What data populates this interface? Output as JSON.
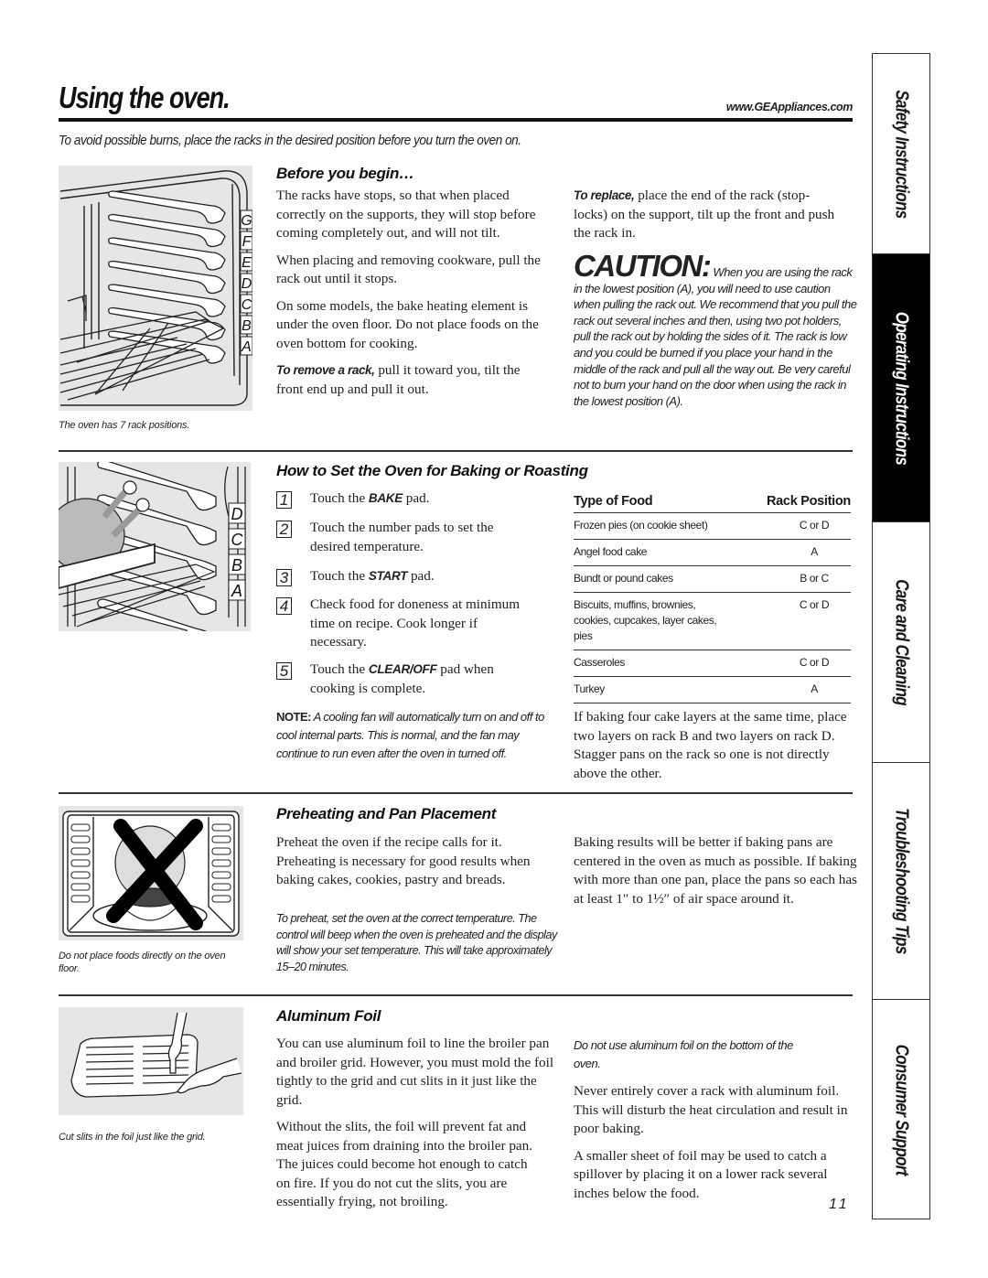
{
  "header": {
    "title": "Using the oven.",
    "url": "www.GEAppliances.com",
    "intro": "To avoid possible burns, place the racks in the desired position before you turn the oven on."
  },
  "side_tabs": [
    {
      "label": "Safety Instructions",
      "active": false
    },
    {
      "label": "Operating Instructions",
      "active": true
    },
    {
      "label": "Care and Cleaning",
      "active": false
    },
    {
      "label": "Troubleshooting Tips",
      "active": false
    },
    {
      "label": "Consumer Support",
      "active": false
    }
  ],
  "before_you_begin": {
    "heading": "Before you begin…",
    "illustration_labels": [
      "G",
      "F",
      "E",
      "D",
      "C",
      "B",
      "A"
    ],
    "caption": "The oven has 7 rack positions.",
    "paragraphs": [
      "The racks have stops, so that when placed correctly on the supports, they will stop before coming completely out, and will not tilt.",
      "When placing and removing cookware, pull the rack out until it stops.",
      "On some models, the bake heating element is under the oven floor. Do not place foods on the oven bottom for cooking."
    ],
    "remove": {
      "lead": "To remove a rack,",
      "text": " pull it toward you, tilt the front end up and pull it out."
    },
    "replace": {
      "lead": "To replace,",
      "text": " place the end of the rack (stop-locks) on the support, tilt up the front and push the rack in."
    },
    "caution": {
      "word": "CAUTION:",
      "text": " When you are using the rack in the lowest position (A), you will need to use caution when pulling the rack out. We recommend that you pull the rack out several inches and then, using two pot holders, pull the rack out by holding the sides of it. The rack is low and you could be burned if you place your hand in the middle of the rack and pull all the way out. Be very careful not to burn your hand on the door when using the rack in the lowest position (A)."
    }
  },
  "baking": {
    "heading": "How to Set the Oven for Baking or Roasting",
    "illustration_labels": [
      "D",
      "C",
      "B",
      "A"
    ],
    "steps": [
      {
        "num": "1",
        "pre": "Touch the ",
        "key": "BAKE",
        "post": " pad."
      },
      {
        "num": "2",
        "pre": "Touch the number pads to set the desired temperature.",
        "key": "",
        "post": ""
      },
      {
        "num": "3",
        "pre": "Touch the ",
        "key": "START",
        "post": " pad."
      },
      {
        "num": "4",
        "pre": "Check food for doneness at minimum time on recipe. Cook longer if necessary.",
        "key": "",
        "post": ""
      },
      {
        "num": "5",
        "pre": "Touch the ",
        "key": "CLEAR/OFF",
        "post": " pad when cooking is complete."
      }
    ],
    "note_label": "NOTE:",
    "note_text": " A cooling fan will automatically turn on and off to cool internal parts. This is normal, and the fan may continue to run even after the oven in turned off.",
    "table": {
      "headers": [
        "Type of Food",
        "Rack Position"
      ],
      "rows": [
        {
          "food": "Frozen pies (on cookie sheet)",
          "position": "C or D"
        },
        {
          "food": "Angel food cake",
          "position": "A"
        },
        {
          "food": "Bundt or pound cakes",
          "position": "B or C"
        },
        {
          "food": "Biscuits, muffins, brownies, cookies, cupcakes, layer cakes, pies",
          "position": "C or D"
        },
        {
          "food": "Casseroles",
          "position": "C or D"
        },
        {
          "food": "Turkey",
          "position": "A"
        }
      ]
    },
    "cake_layers": "If baking four cake layers at the same time, place two layers on rack B and two layers on rack D. Stagger pans on the rack so one is not directly above the other."
  },
  "preheating": {
    "heading": "Preheating and Pan Placement",
    "caption": "Do not place foods directly on the oven floor.",
    "paragraph": "Preheat the oven if the recipe calls for it. Preheating is necessary for good results when baking cakes, cookies, pastry and breads.",
    "italic_note": "To preheat, set the oven at the correct temperature. The control will beep when the oven is preheated and the display will show your set temperature. This will take approximately 15–20 minutes.",
    "pan_placement": "Baking results will be better if baking pans are centered in the oven as much as possible. If baking with more than one pan, place the pans so each has at least 1″ to 1½″ of air space around it."
  },
  "aluminum_foil": {
    "heading": "Aluminum Foil",
    "caption": "Cut slits in the foil just like the grid.",
    "paragraphs": [
      "You can use aluminum foil to line the broiler pan and broiler grid. However, you must mold the foil tightly to the grid and cut slits in it just like the grid.",
      "Without the slits, the foil will prevent fat and meat juices from draining into the broiler pan. The juices could become hot enough to catch on fire. If you do not cut the slits, you are essentially frying, not broiling."
    ],
    "italic_note": "Do not use aluminum foil on the bottom of the oven.",
    "right_paragraphs": [
      "Never entirely cover a rack with aluminum foil. This will disturb the heat circulation and result in poor baking.",
      "A smaller sheet of foil may be used to catch a spillover by placing it on a lower rack several inches below the food."
    ]
  },
  "page_number": "11"
}
